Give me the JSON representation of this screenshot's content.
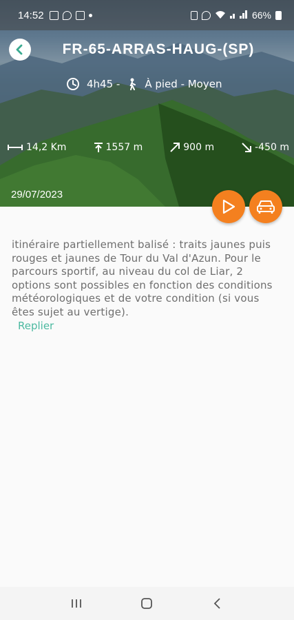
{
  "status_bar": {
    "time": "14:52",
    "battery": "66%"
  },
  "header": {
    "title": "FR-65-ARRAS-HAUG-(SP)",
    "duration": "4h45 -",
    "mode": "À pied - Moyen"
  },
  "stats": {
    "distance": "14,2 Km",
    "max_altitude": "1557 m",
    "elevation_gain": "900 m",
    "elevation_loss": "-450 m"
  },
  "date": "29/07/2023",
  "description": "itinéraire partiellement balisé : traits jaunes puis rouges et jaunes de Tour du Val d'Azun. Pour le parcours sportif, au niveau du col de Liar, 2 options sont possibles en fonction des conditions météorologiques et de votre condition (si vous êtes sujet au vertige).",
  "collapse_label": "Replier",
  "colors": {
    "accent_orange": "#f4801f",
    "link_teal": "#4bb9a0"
  }
}
